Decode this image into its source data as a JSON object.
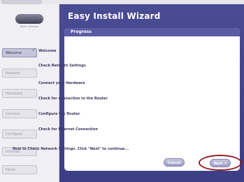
{
  "sidebar": {
    "logo_caption": "Belkin Wireless",
    "steps": [
      {
        "label": "Welcome",
        "active": true
      },
      {
        "label": "Network",
        "active": false
      },
      {
        "label": "Hardware",
        "active": false
      },
      {
        "label": "Connect",
        "active": false
      },
      {
        "label": "Configure",
        "active": false
      },
      {
        "label": "Internet",
        "active": false
      },
      {
        "label": "Finish",
        "active": false
      }
    ]
  },
  "header": {
    "title": "Easy Install Wizard"
  },
  "panel": {
    "title": "Progress",
    "checkmark": "✓",
    "items": [
      "Welcome",
      "Check Network Settings",
      "Connect your Hardware",
      "Check for connection to the Router",
      "Configure the Router",
      "Check for Internet Connection"
    ],
    "instruction": "Now to Check Network Settings. Click \"Next\" to continue..."
  },
  "buttons": {
    "cancel": "Cancel",
    "next": "Next >"
  },
  "colors": {
    "accent": "#4a4c93",
    "highlight": "#8e1c24"
  }
}
